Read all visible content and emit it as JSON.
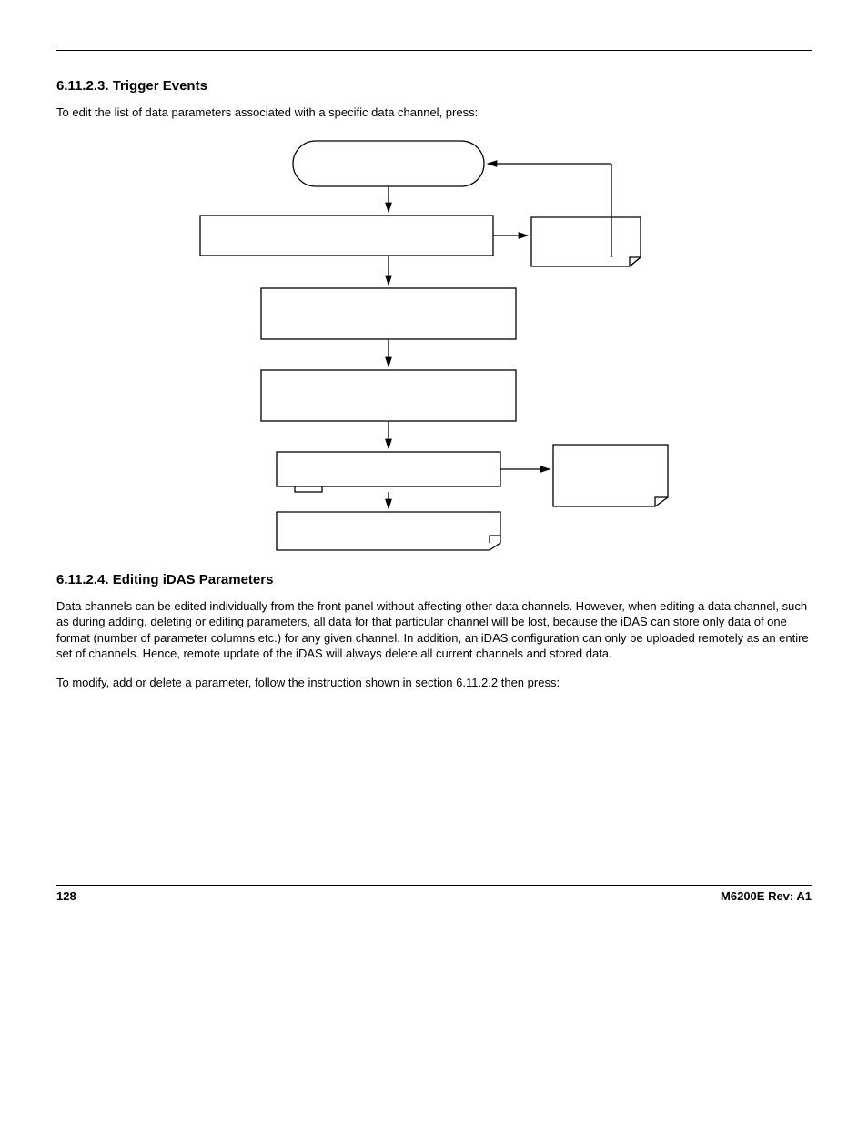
{
  "section1": {
    "heading": "6.11.2.3. Trigger Events",
    "intro": "To edit the list of data parameters associated with a specific data channel, press:"
  },
  "section2": {
    "heading": "6.11.2.4. Editing iDAS Parameters",
    "para1": "Data channels can be edited individually from the front panel without affecting other data channels. However, when editing a data channel, such as during adding, deleting or editing parameters, all data for that particular channel will be lost, because the iDAS can store only data of one format (number of parameter columns etc.) for any given channel. In addition, an iDAS configuration can only be uploaded remotely as an entire set of channels. Hence, remote update of the iDAS will always delete all current channels and stored data.",
    "para2": "To modify, add or delete a parameter, follow the instruction shown in section 6.11.2.2 then press:"
  },
  "footer": {
    "page": "128",
    "rev": "M6200E Rev: A1"
  }
}
